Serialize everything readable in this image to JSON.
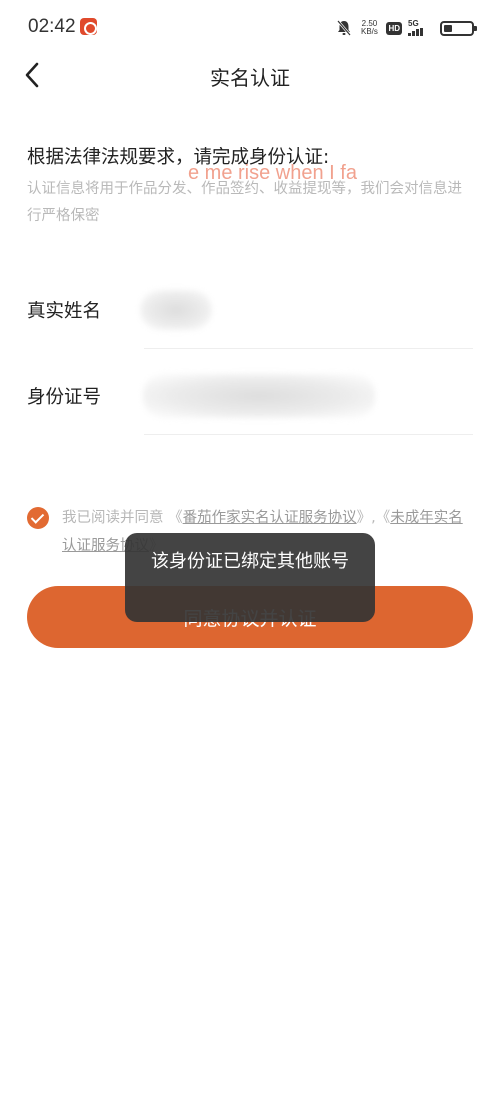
{
  "status_bar": {
    "time": "02:42",
    "net_speed_value": "2.50",
    "net_speed_unit": "KB/s",
    "hd_label": "HD",
    "network": "5G",
    "battery_level": 0.3
  },
  "nav": {
    "title": "实名认证"
  },
  "intro": {
    "title": "根据法律法规要求，请完成身份认证:",
    "description": "认证信息将用于作品分发、作品签约、收益提现等，我们会对信息进行严格保密",
    "watermark_text": "e me rise when I fa"
  },
  "form": {
    "name_label": "真实姓名",
    "id_label": "身份证号"
  },
  "agreement": {
    "prefix": "我已阅读并同意 《",
    "link1": "番茄作家实名认证服务协议",
    "middle": "》,《",
    "link2": "未成年实名认证服务协议",
    "suffix": "》",
    "checked": true
  },
  "submit_label": "同意协议并认证",
  "toast_text": "该身份证已绑定其他账号",
  "colors": {
    "accent": "#dd6630",
    "toast_bg": "#343434"
  }
}
